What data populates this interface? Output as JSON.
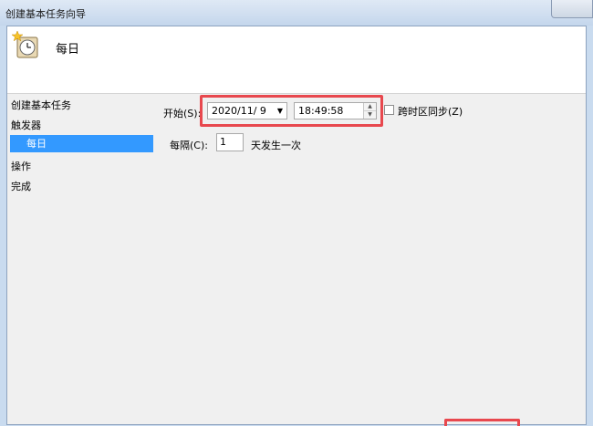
{
  "window": {
    "title": "创建基本任务向导"
  },
  "header": {
    "title": "每日"
  },
  "nav": {
    "items": [
      {
        "label": "创建基本任务"
      },
      {
        "label": "触发器"
      },
      {
        "label": "每日"
      },
      {
        "label": "操作"
      },
      {
        "label": "完成"
      }
    ],
    "selected_index": 2
  },
  "trigger": {
    "start_label": "开始(S):",
    "date_value": "2020/11/ 9",
    "time_value": "18:49:58",
    "timezone_sync_label": "跨时区同步(Z)",
    "timezone_sync_checked": false,
    "recur_label": "每隔(C):",
    "recur_value": "1",
    "recur_suffix": "天发生一次"
  },
  "icons": {
    "header": "task-clock-icon",
    "dropdown": "chevron-down-icon",
    "spin_up": "spin-up-icon",
    "spin_down": "spin-down-icon"
  },
  "colors": {
    "selection": "#3399ff",
    "highlight": "#e8484e"
  }
}
